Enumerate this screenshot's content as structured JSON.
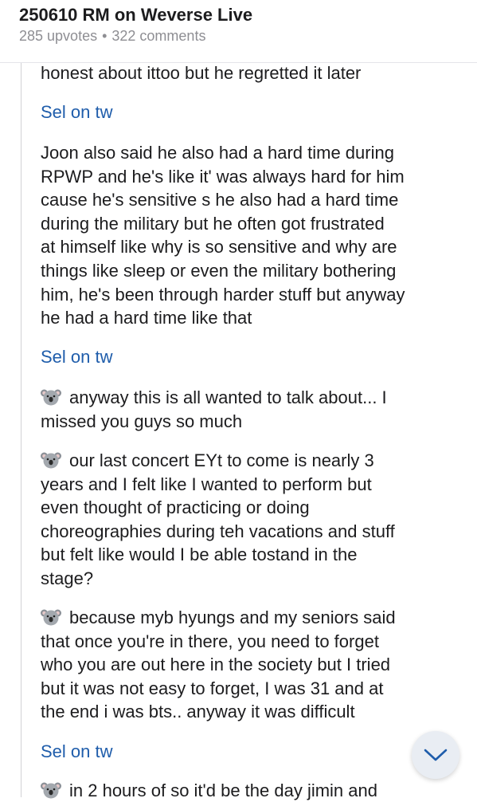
{
  "header": {
    "title": "250610 RM on Weverse Live",
    "upvotes": "285 upvotes",
    "separator": "•",
    "comments": "322 comments"
  },
  "comment": {
    "partial_top": "honest about ittoo but he regretted it later",
    "link_1": "Sel on tw",
    "para_1": [
      "Joon also said he also had a hard time during",
      "RPWP and he's like it' was always hard for him",
      "cause he's sensitive s he also had a hard time",
      "during the military but he often got frustrated",
      "at himself like why is so sensitive and why are",
      "things like sleep or even the military bothering",
      "him, he's been through harder stuff but anyway",
      "he had a hard time like that"
    ],
    "link_2": "Sel on tw",
    "koala_1": [
      "anyway this is all wanted to talk about... I",
      "missed you guys so much"
    ],
    "koala_2": [
      "our last concert EYt to come is nearly 3",
      "years and I felt like I wanted to perform but",
      "even thought of practicing or doing",
      "choreographies during teh vacations and stuff",
      "but felt like would I be able tostand in the",
      "stage?"
    ],
    "koala_3": [
      "because myb hyungs and my seniors said",
      "that once you're in there, you need to forget",
      "who you are out here in the society but I tried",
      "but it was not easy to forget, I was 31 and at",
      "the end i was bts.. anyway it was difficult"
    ],
    "link_3": "Sel on tw",
    "koala_4_partial": "in 2 hours of so it'd be the day jimin and"
  },
  "icons": {
    "koala": "koala-emoji-icon",
    "scroll_down": "chevron-down-icon"
  },
  "colors": {
    "link": "#1f5dab",
    "text": "#1c1c1e",
    "meta": "#8e8e93",
    "fab_bg": "#e9edf3",
    "fab_icon": "#1f5dab"
  }
}
